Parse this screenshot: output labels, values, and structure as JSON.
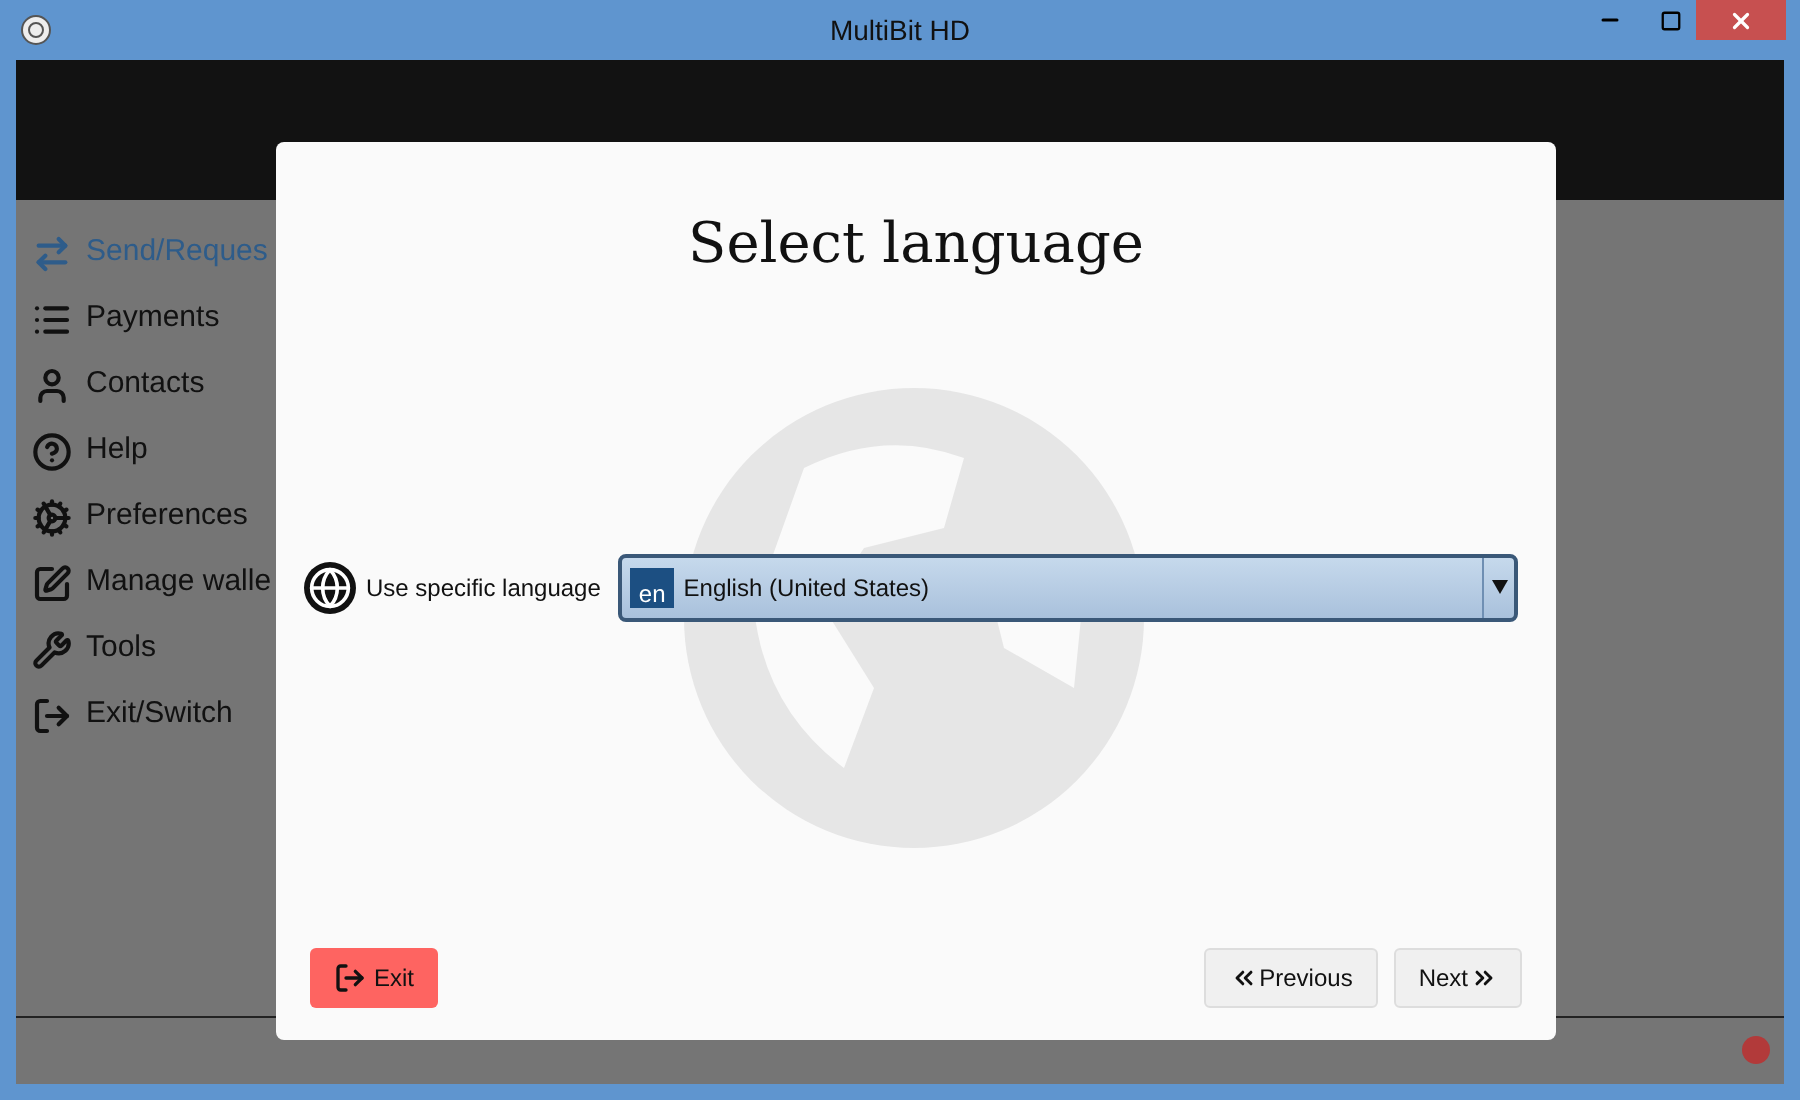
{
  "window": {
    "title": "MultiBit HD"
  },
  "sidebar": {
    "items": [
      {
        "label": "Send/Reques",
        "selected": true
      },
      {
        "label": "Payments",
        "selected": false
      },
      {
        "label": "Contacts",
        "selected": false
      },
      {
        "label": "Help",
        "selected": false
      },
      {
        "label": "Preferences",
        "selected": false
      },
      {
        "label": "Manage walle",
        "selected": false
      },
      {
        "label": "Tools",
        "selected": false
      },
      {
        "label": "Exit/Switch",
        "selected": false
      }
    ]
  },
  "dialog": {
    "title": "Select language",
    "language_label": "Use specific language",
    "language_select": {
      "code": "en",
      "value": "English (United States)"
    },
    "buttons": [
      {
        "label": "Exit",
        "kind": "exit"
      },
      {
        "label": "Previous",
        "kind": "previous"
      },
      {
        "label": "Next",
        "kind": "next"
      }
    ]
  }
}
